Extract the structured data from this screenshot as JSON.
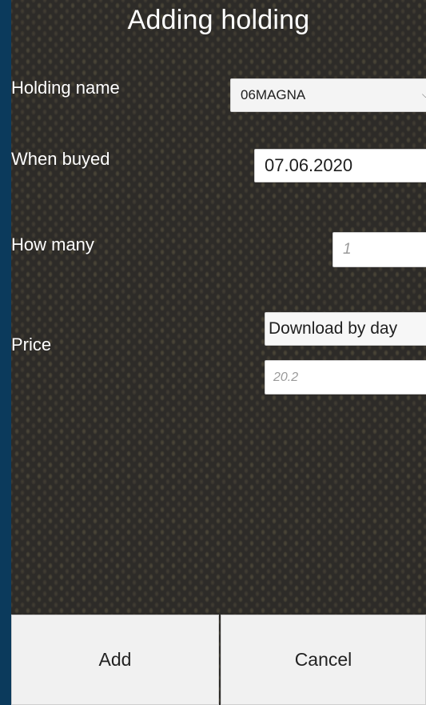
{
  "dialog": {
    "title": "Adding holding"
  },
  "form": {
    "holding_name": {
      "label": "Holding name",
      "selected": "06MAGNA"
    },
    "when_buyed": {
      "label": "When buyed",
      "value": "07.06.2020"
    },
    "how_many": {
      "label": "How many",
      "placeholder": "1"
    },
    "price": {
      "label": "Price",
      "source_selected": "Download by day",
      "placeholder": "20.2"
    }
  },
  "buttons": {
    "add": "Add",
    "cancel": "Cancel"
  },
  "icons": {
    "dropdown": "chevron-down-icon"
  },
  "colors": {
    "frame": "#0b3a5c",
    "panel": "#2d2b28",
    "button_bg": "#f1f1f1"
  }
}
